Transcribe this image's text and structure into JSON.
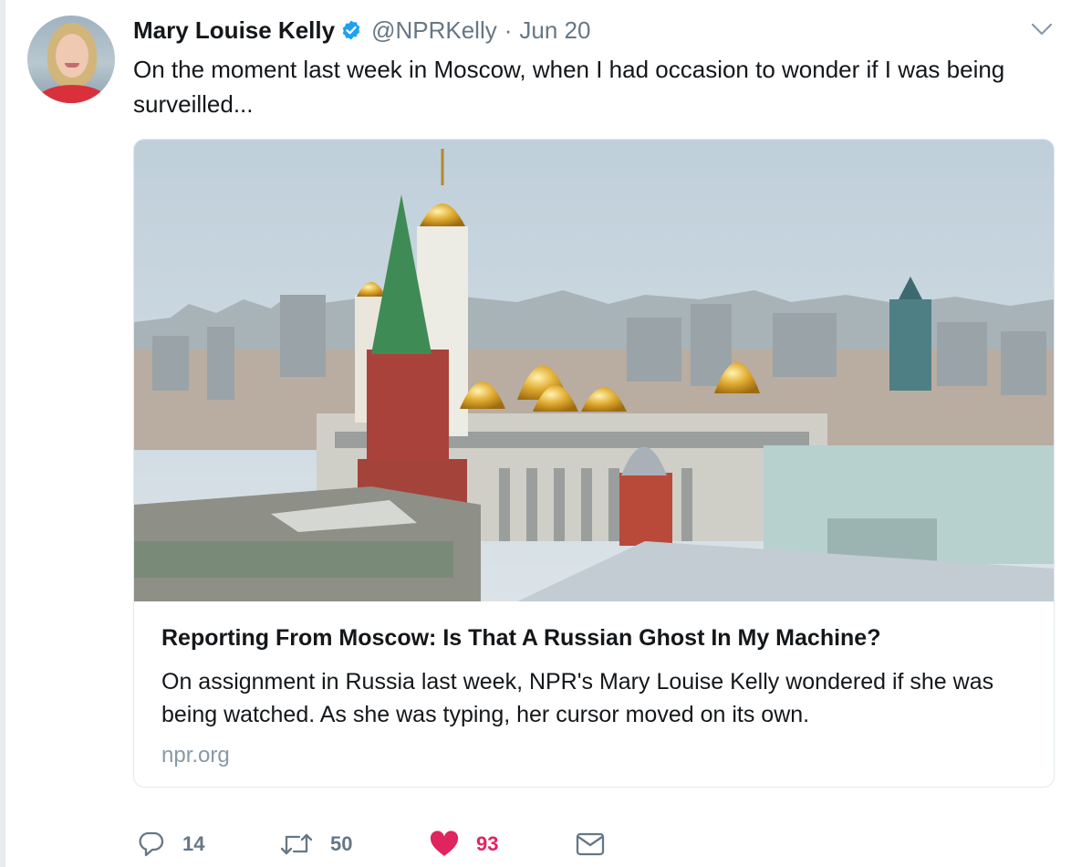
{
  "tweet": {
    "author_name": "Mary Louise Kelly",
    "handle": "@NPRKelly",
    "separator": "·",
    "date": "Jun 20",
    "text": "On the moment last week in Moscow, when I had occasion to wonder if I was being surveilled...",
    "verified": true
  },
  "card": {
    "title": "Reporting From Moscow: Is That A Russian Ghost In My Machine?",
    "description": "On assignment in Russia last week, NPR's Mary Louise Kelly wondered if she was being watched. As she was typing, her cursor moved on its own.",
    "domain": "npr.org",
    "image_subject": "Moscow skyline with Kremlin towers and golden onion domes"
  },
  "actions": {
    "reply": {
      "icon": "reply-icon",
      "count": "14"
    },
    "retweet": {
      "icon": "retweet-icon",
      "count": "50"
    },
    "like": {
      "icon": "heart-icon",
      "count": "93",
      "liked": true
    },
    "dm": {
      "icon": "envelope-icon"
    }
  },
  "colors": {
    "text": "#14171a",
    "secondary": "#657786",
    "verified_blue": "#1da1f2",
    "like_red": "#e0245e",
    "card_border": "#e1e8ed"
  }
}
